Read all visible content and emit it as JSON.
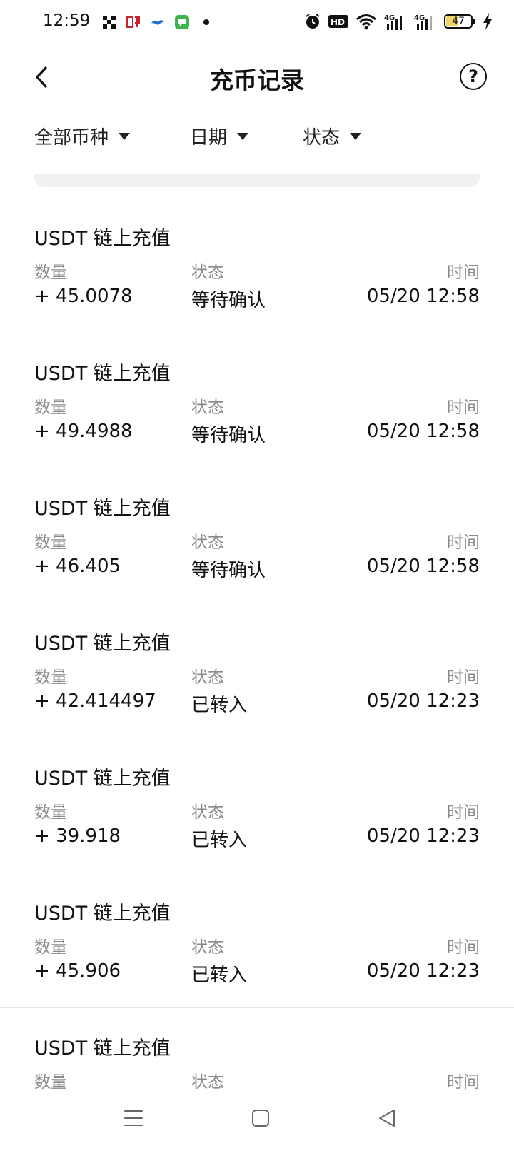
{
  "status_bar": {
    "time": "12:59",
    "network_1": "4G",
    "network_2": "4G",
    "hd_label": "HD",
    "battery": "47",
    "battery_level": 0.47
  },
  "header": {
    "title": "充币记录",
    "help_label": "?"
  },
  "filters": {
    "coin": "全部币种",
    "date": "日期",
    "status": "状态"
  },
  "records": [
    {
      "title": "USDT 链上充值",
      "amount_label": "数量",
      "amount": "+ 45.0078",
      "status_label": "状态",
      "status": "等待确认",
      "time_label": "时间",
      "time": "05/20 12:58"
    },
    {
      "title": "USDT 链上充值",
      "amount_label": "数量",
      "amount": "+ 49.4988",
      "status_label": "状态",
      "status": "等待确认",
      "time_label": "时间",
      "time": "05/20 12:58"
    },
    {
      "title": "USDT 链上充值",
      "amount_label": "数量",
      "amount": "+ 46.405",
      "status_label": "状态",
      "status": "等待确认",
      "time_label": "时间",
      "time": "05/20 12:58"
    },
    {
      "title": "USDT 链上充值",
      "amount_label": "数量",
      "amount": "+ 42.414497",
      "status_label": "状态",
      "status": "已转入",
      "time_label": "时间",
      "time": "05/20 12:23"
    },
    {
      "title": "USDT 链上充值",
      "amount_label": "数量",
      "amount": "+ 39.918",
      "status_label": "状态",
      "status": "已转入",
      "time_label": "时间",
      "time": "05/20 12:23"
    },
    {
      "title": "USDT 链上充值",
      "amount_label": "数量",
      "amount": "+ 45.906",
      "status_label": "状态",
      "status": "已转入",
      "time_label": "时间",
      "time": "05/20 12:23"
    },
    {
      "title": "USDT 链上充值",
      "amount_label": "数量",
      "amount": "",
      "status_label": "状态",
      "status": "",
      "time_label": "时间",
      "time": ""
    }
  ],
  "icons": {
    "back": "chevron-left-icon",
    "help": "question-circle-icon",
    "nav_menu": "menu-lines-icon",
    "nav_home": "square-home-icon",
    "nav_back": "triangle-back-icon"
  },
  "colors": {
    "text": "#111111",
    "label": "#8a8a8a",
    "divider": "#e4e4e4",
    "battery_fill": "#f2d36b"
  }
}
